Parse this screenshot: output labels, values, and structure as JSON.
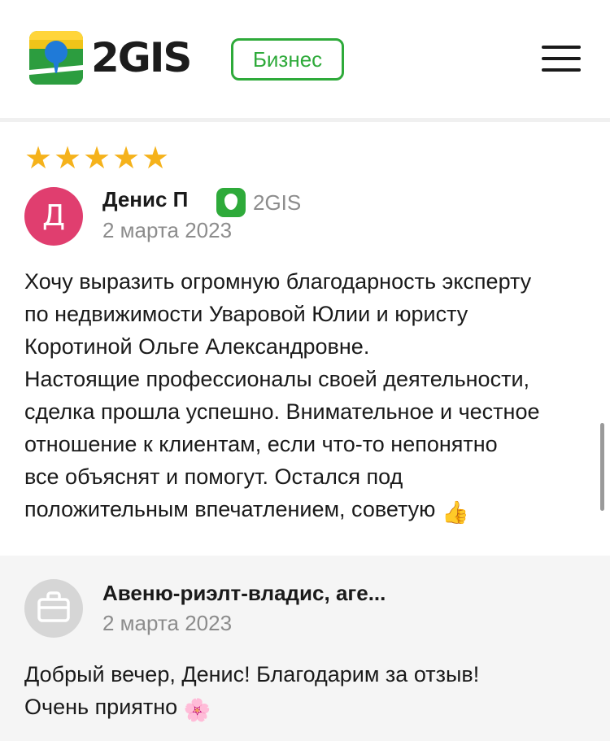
{
  "header": {
    "logo_text": "2GIS",
    "business_label": "Бизнес",
    "menu_icon": "hamburger-icon"
  },
  "review": {
    "rating": 5,
    "rating_max": 5,
    "star_icon": "star-icon",
    "avatar_letter": "Д",
    "avatar_color": "#e03e6f",
    "author": "Денис П",
    "source": "2GIS",
    "date": "2 марта 2023",
    "text": "Хочу выразить огромную благодарность эксперту\nпо недвижимости Уваровой Юлии и юристу\nКоротиной Ольге Александровне.\nНастоящие профессионалы своей деятельности,\nсделка прошла успешно. Внимательное и честное\nотношение к клиентам, если что-то непонятно\nвсе объяснят и помогут. Остался под\nположительным впечатлением, советую",
    "text_emoji": "👍"
  },
  "reply": {
    "avatar_icon": "briefcase-icon",
    "author": "Авеню-риэлт-владис, аге...",
    "date": "2 марта 2023",
    "text": "Добрый вечер, Денис! Благодарим за отзыв!\nОчень приятно",
    "text_emoji": "🌸"
  },
  "colors": {
    "brand_green": "#2eaa3a",
    "star": "#f5b21b",
    "muted_text": "#8c8c8c",
    "reply_bg": "#f5f5f5"
  }
}
